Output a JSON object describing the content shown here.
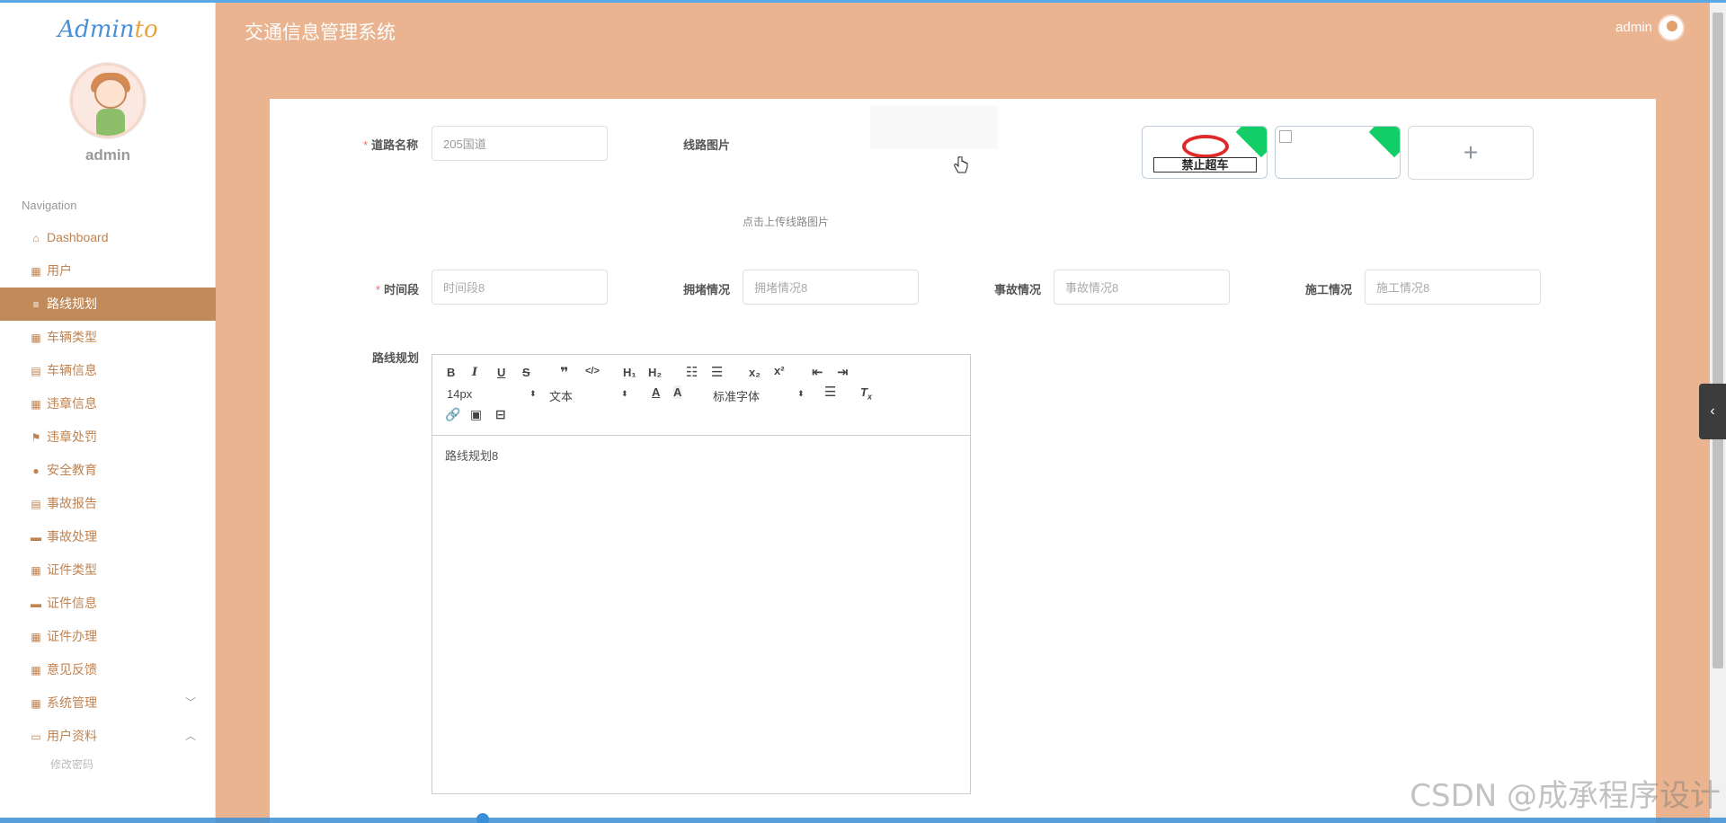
{
  "app": {
    "brand_main": "Admin",
    "brand_accent": "to",
    "header_title": "交通信息管理系统",
    "header_user": "admin"
  },
  "sidebar": {
    "username": "admin",
    "nav_title": "Navigation",
    "items": [
      {
        "label": "Dashboard",
        "icon": "home-icon"
      },
      {
        "label": "用户",
        "icon": "grid-icon"
      },
      {
        "label": "路线规划",
        "icon": "list-icon",
        "active": true
      },
      {
        "label": "车辆类型",
        "icon": "grid-icon"
      },
      {
        "label": "车辆信息",
        "icon": "clipboard-icon"
      },
      {
        "label": "违章信息",
        "icon": "grid-icon"
      },
      {
        "label": "违章处罚",
        "icon": "flag-icon"
      },
      {
        "label": "安全教育",
        "icon": "pin-icon"
      },
      {
        "label": "事故报告",
        "icon": "clipboard-icon"
      },
      {
        "label": "事故处理",
        "icon": "ticket-icon"
      },
      {
        "label": "证件类型",
        "icon": "grid-icon"
      },
      {
        "label": "证件信息",
        "icon": "comment-icon"
      },
      {
        "label": "证件办理",
        "icon": "grid-icon"
      },
      {
        "label": "意见反馈",
        "icon": "grid-icon"
      },
      {
        "label": "系统管理",
        "icon": "grid-icon",
        "chevron": "down"
      },
      {
        "label": "用户资料",
        "icon": "card-icon",
        "chevron": "up"
      }
    ],
    "sub_item": "修改密码"
  },
  "form": {
    "road_name_label": "道路名称",
    "road_name_value": "205国道",
    "route_image_label": "线路图片",
    "upload_hint": "点击上传线路图片",
    "sign_text": "禁止超车",
    "upload_add": "+",
    "time_label": "时间段",
    "time_placeholder": "时间段8",
    "congestion_label": "拥堵情况",
    "congestion_placeholder": "拥堵情况8",
    "accident_label": "事故情况",
    "accident_placeholder": "事故情况8",
    "construction_label": "施工情况",
    "construction_placeholder": "施工情况8",
    "route_plan_label": "路线规划",
    "route_plan_content": "路线规划8"
  },
  "editor": {
    "font_size": "14px",
    "block_type": "文本",
    "font_family": "标准字体"
  },
  "watermark": "CSDN @成承程序设计",
  "colors": {
    "accent": "#c08a5a",
    "sidebar_text": "#c08350",
    "background": "#e9b48f",
    "required": "#f56c6c"
  }
}
